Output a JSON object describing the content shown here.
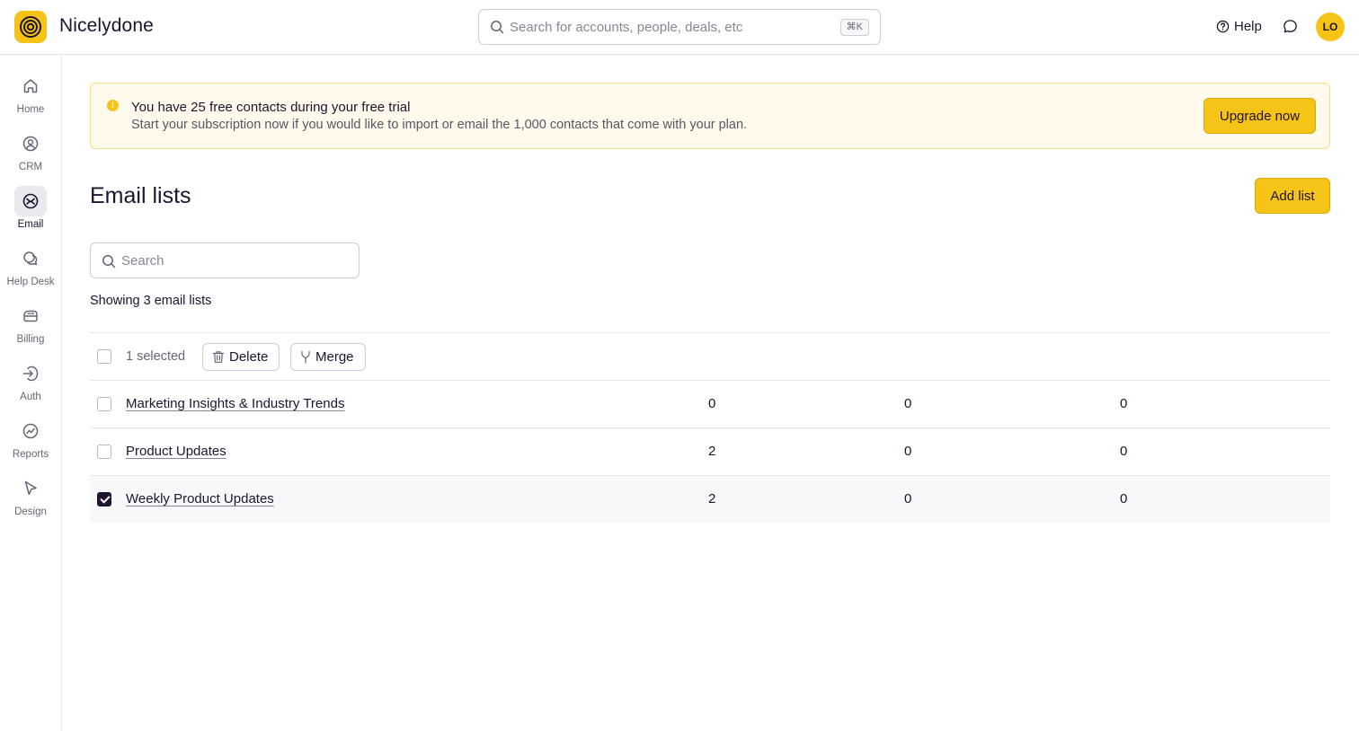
{
  "app": {
    "name": "Nicelydone"
  },
  "header": {
    "search_placeholder": "Search for accounts, people, deals, etc",
    "shortcut": "⌘K",
    "help_label": "Help",
    "avatar_initials": "LO"
  },
  "sidebar": {
    "items": [
      {
        "label": "Home",
        "icon": "home-icon"
      },
      {
        "label": "CRM",
        "icon": "user-circle-icon"
      },
      {
        "label": "Email",
        "icon": "email-icon",
        "active": true
      },
      {
        "label": "Help Desk",
        "icon": "chat-bubbles-icon"
      },
      {
        "label": "Billing",
        "icon": "billing-icon"
      },
      {
        "label": "Auth",
        "icon": "login-icon"
      },
      {
        "label": "Reports",
        "icon": "reports-icon"
      },
      {
        "label": "Design",
        "icon": "cursor-icon"
      }
    ]
  },
  "banner": {
    "title": "You have 25 free contacts during your free trial",
    "subtitle": "Start your subscription now if you would like to import or email the 1,000 contacts that come with your plan.",
    "cta": "Upgrade now"
  },
  "page": {
    "title": "Email lists",
    "add_button": "Add list",
    "search_placeholder": "Search",
    "showing_text": "Showing 3 email lists"
  },
  "toolbar": {
    "selected_text": "1 selected",
    "delete_label": "Delete",
    "merge_label": "Merge"
  },
  "lists": [
    {
      "name": "Marketing Insights & Industry Trends",
      "col1": "0",
      "col2": "0",
      "col3": "0",
      "checked": false
    },
    {
      "name": "Product Updates",
      "col1": "2",
      "col2": "0",
      "col3": "0",
      "checked": false
    },
    {
      "name": "Weekly Product Updates",
      "col1": "2",
      "col2": "0",
      "col3": "0",
      "checked": true
    }
  ],
  "colors": {
    "accent": "#f6c416",
    "text": "#1f1330",
    "banner_bg": "#fffaeb"
  }
}
